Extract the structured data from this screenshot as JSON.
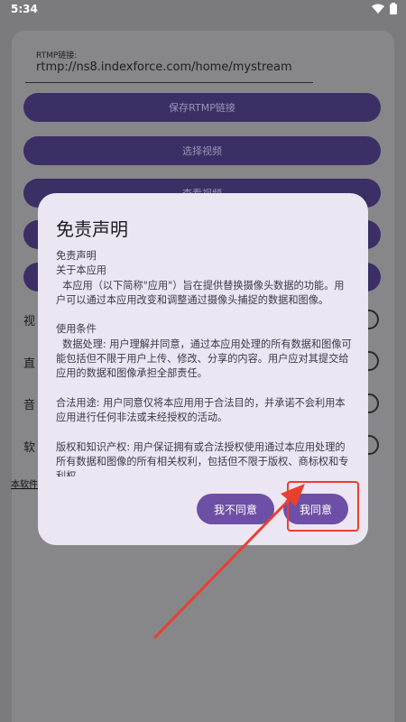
{
  "status_bar": {
    "time": "5:34",
    "wifi_icon": "wifi-icon",
    "battery_icon": "battery-icon"
  },
  "form": {
    "rtmp_label": "RTMP链接:",
    "rtmp_value": "rtmp://ns8.indexforce.com/home/mystream",
    "save_button": "保存RTMP链接",
    "select_video_button": "选择视频",
    "view_video_button": "查看视频",
    "option_rows": [
      "视",
      "直",
      "音",
      "软"
    ],
    "footer_link": "本软件"
  },
  "dialog": {
    "title": "免责声明",
    "body": "免责声明\n关于本应用\n  本应用（以下简称\"应用\"）旨在提供替换摄像头数据的功能。用户可以通过本应用改变和调整通过摄像头捕捉的数据和图像。\n\n使用条件\n  数据处理: 用户理解并同意，通过本应用处理的所有数据和图像可能包括但不限于用户上传、修改、分享的内容。用户应对其提交给应用的数据和图像承担全部责任。\n\n合法用途: 用户同意仅将本应用用于合法目的，并承诺不会利用本应用进行任何非法或未经授权的活动。\n\n版权和知识产权: 用户保证拥有或合法授权使用通过本应用处理的所有数据和图像的所有相关权利，包括但不限于版权、商标权和专利权。",
    "decline_button": "我不同意",
    "accept_button": "我同意"
  },
  "colors": {
    "accent": "#6e4fa6",
    "highlight": "#e8402f"
  }
}
